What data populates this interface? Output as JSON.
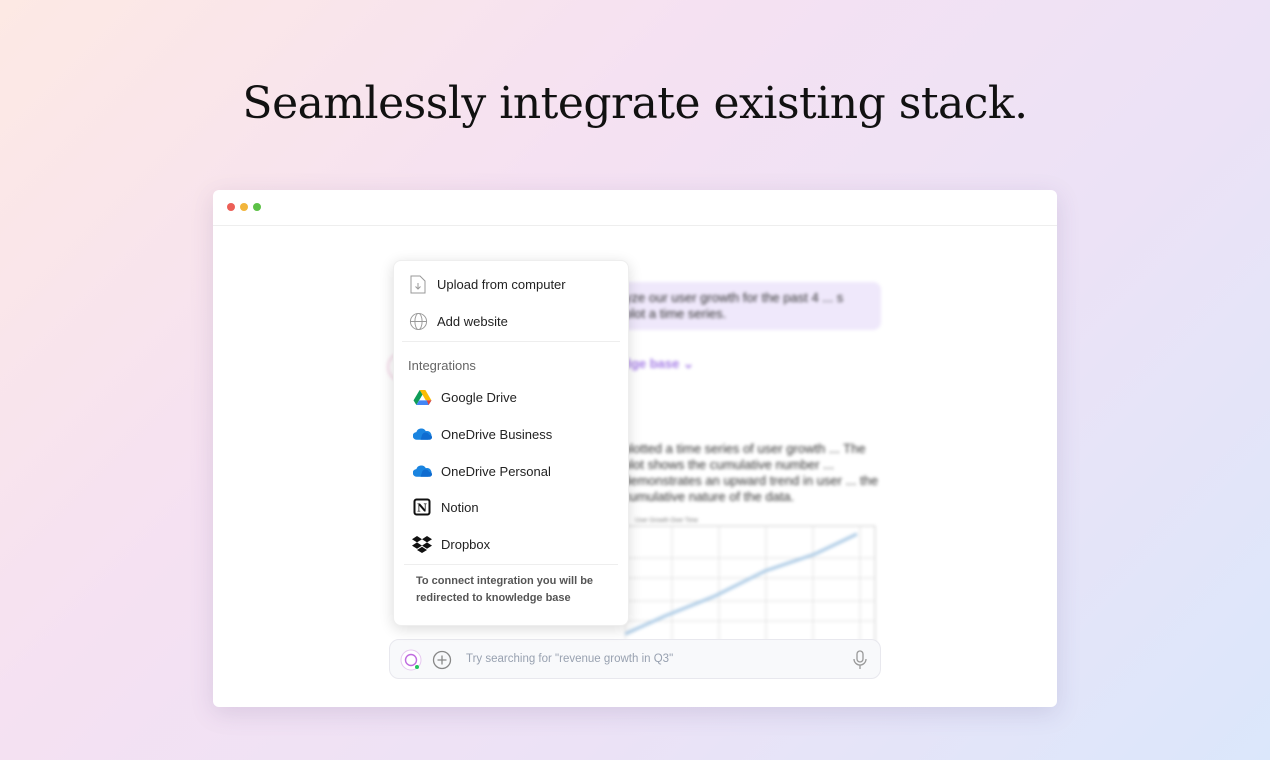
{
  "headline": "Seamlessly integrate existing stack.",
  "window": {
    "controls": {
      "close": "#ec5f57",
      "minimize": "#f2b53b",
      "maximize": "#5cc146"
    }
  },
  "chat": {
    "user_message": "Analyze our user growth for the past 4 ... s and plot a time series.",
    "source_label": "dge base",
    "answer": "plotted a time series of user growth ... The plot shows the cumulative number ... demonstrates an upward trend in user ... the cumulative nature of the data.",
    "chart_title": "User Growth Over Time"
  },
  "menu": {
    "items": [
      {
        "label": "Upload from computer",
        "icon": "file-upload-icon"
      },
      {
        "label": "Add website",
        "icon": "globe-icon"
      }
    ],
    "section_title": "Integrations",
    "integrations": [
      {
        "label": "Google Drive",
        "icon": "google-drive-icon"
      },
      {
        "label": "OneDrive Business",
        "icon": "onedrive-icon"
      },
      {
        "label": "OneDrive Personal",
        "icon": "onedrive-icon"
      },
      {
        "label": "Notion",
        "icon": "notion-icon"
      },
      {
        "label": "Dropbox",
        "icon": "dropbox-icon"
      }
    ],
    "note": "To connect integration you will be redirected to knowledge base"
  },
  "input": {
    "placeholder": "Try searching for \"revenue growth in Q3\""
  }
}
